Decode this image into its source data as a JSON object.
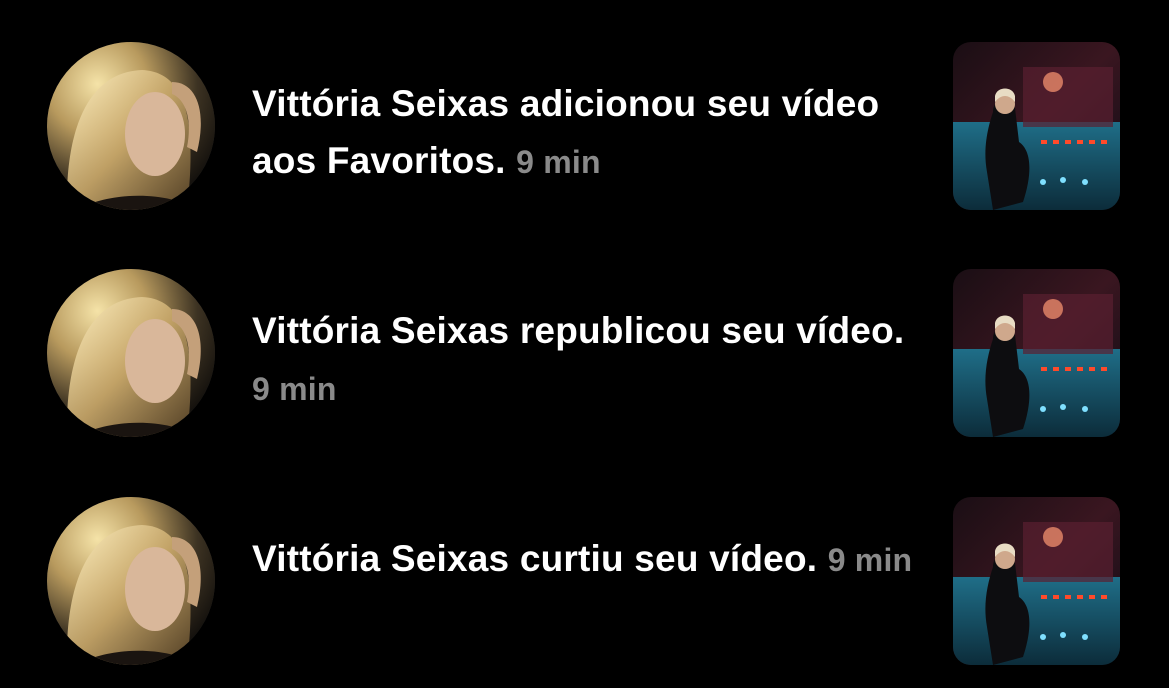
{
  "notifications": [
    {
      "message": "Vittória Seixas adicionou seu vídeo aos Favoritos.",
      "time": "9 min"
    },
    {
      "message": "Vittória Seixas republicou seu vídeo.",
      "time": "9 min"
    },
    {
      "message": "Vittória Seixas curtiu seu vídeo.",
      "time": "9 min"
    }
  ],
  "colors": {
    "background": "#000000",
    "text": "#ffffff",
    "time": "#8a8a8a"
  }
}
